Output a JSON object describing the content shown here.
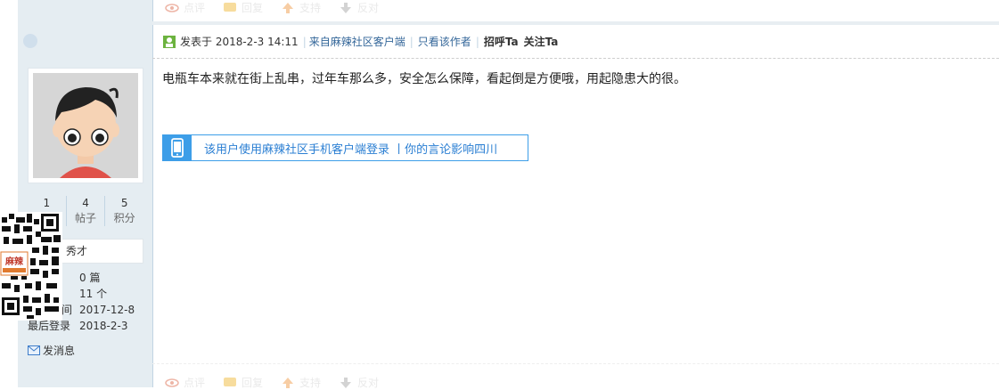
{
  "top_actions": [
    {
      "icon": "eye-icon",
      "label": "点评"
    },
    {
      "icon": "reply-icon",
      "label": "回复"
    },
    {
      "icon": "thumbs-up-icon",
      "label": "支持"
    },
    {
      "icon": "thumbs-down-icon",
      "label": "反对"
    }
  ],
  "user": {
    "stats": [
      {
        "value": "1",
        "label": ""
      },
      {
        "value": "4",
        "label": "帖子"
      },
      {
        "value": "5",
        "label": "积分"
      }
    ],
    "rank": "秀才",
    "info": [
      {
        "key": "",
        "value": "0 篇"
      },
      {
        "key": "",
        "value": "11 个"
      },
      {
        "key": "间",
        "value": "2017-12-8"
      },
      {
        "key": "最后登录",
        "value": "2018-2-3"
      }
    ],
    "send_message": "发消息",
    "qr_brand": "麻辣"
  },
  "post": {
    "posted_label": "发表于 2018-2-3 14:11",
    "source": "来自麻辣社区客户端",
    "only_author": "只看该作者",
    "greet": "招呼Ta",
    "follow": "关注Ta",
    "content": "电瓶车本来就在街上乱串，过年车那么多，安全怎么保障，看起倒是方便哦，用起隐患大的很。",
    "mobile_note": "该用户使用麻辣社区手机客户端登录 丨你的言论影响四川"
  },
  "bottom_actions": [
    {
      "icon": "eye-icon",
      "label": "点评"
    },
    {
      "icon": "reply-icon",
      "label": "回复"
    },
    {
      "icon": "thumbs-up-icon",
      "label": "支持"
    },
    {
      "icon": "thumbs-down-icon",
      "label": "反对"
    }
  ]
}
